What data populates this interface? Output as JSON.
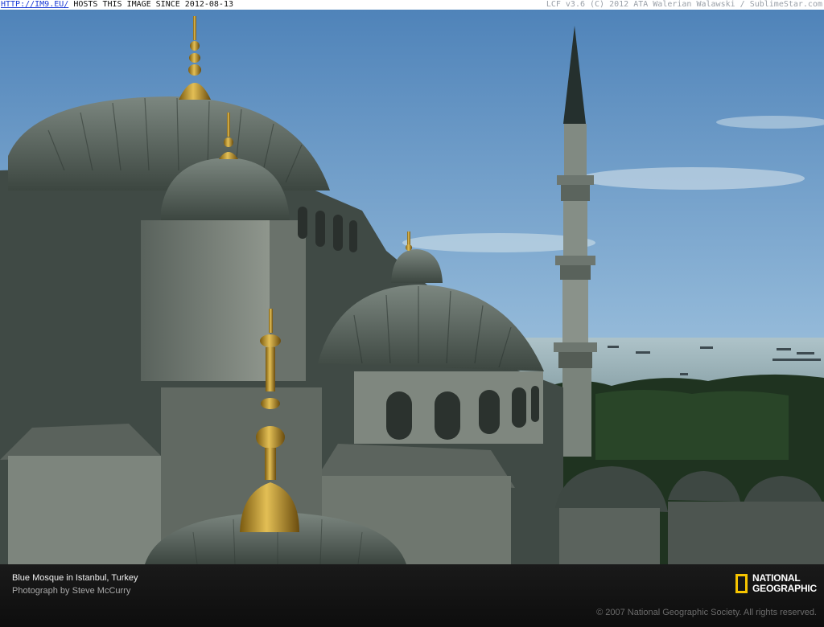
{
  "topbar": {
    "link_text": "HTTP://IM9.EU/",
    "hosts_text": " HOSTS THIS IMAGE SINCE 2012-08-13",
    "right_text": "LCF v3.6 (C) 2012 ATA Walerian Walawski / SublimeStar.com"
  },
  "caption": {
    "title": "Blue Mosque in Istanbul, Turkey",
    "credit": "Photograph by Steve McCurry",
    "copyright": "© 2007 National Geographic Society. All rights reserved.",
    "logo_line1": "NATIONAL",
    "logo_line2": "GEOGRAPHIC"
  },
  "colors": {
    "logo_yellow": "#f6c400",
    "link_blue": "#1a3bd6"
  }
}
